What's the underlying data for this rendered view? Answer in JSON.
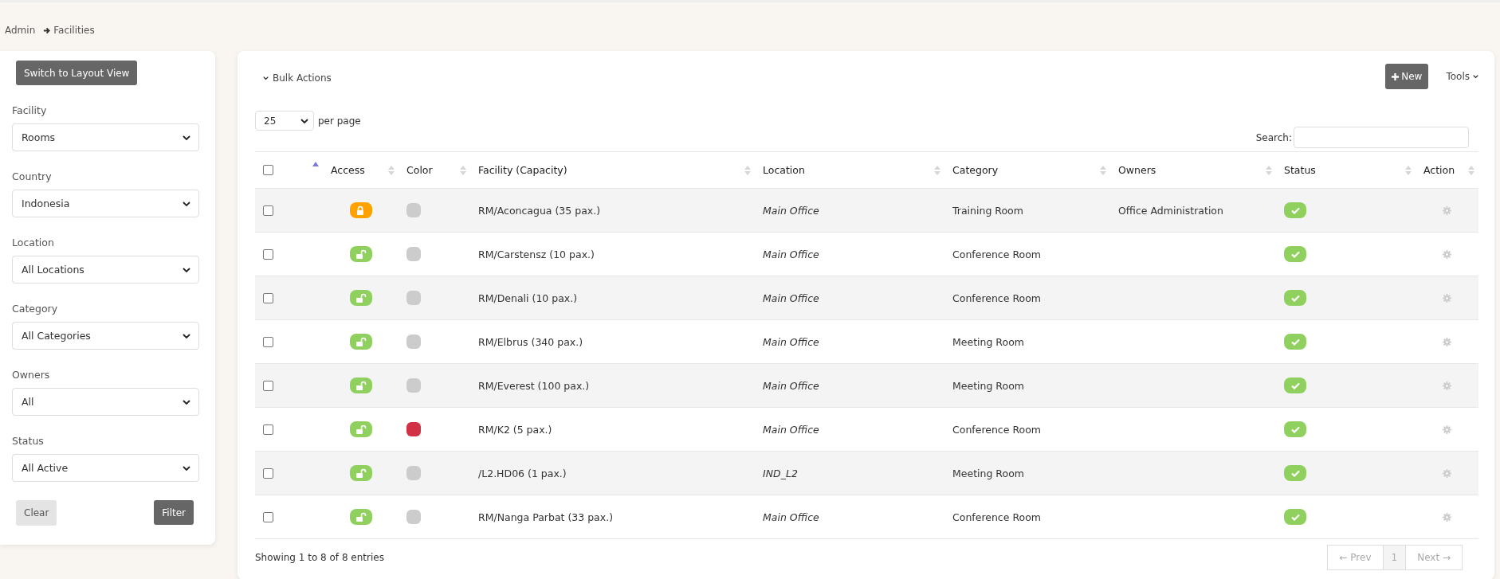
{
  "breadcrumb": {
    "items": [
      "Admin",
      "Facilities"
    ]
  },
  "filters": {
    "switch_button": "Switch to Layout View",
    "fields": [
      {
        "label": "Facility",
        "value": "Rooms"
      },
      {
        "label": "Country",
        "value": "Indonesia"
      },
      {
        "label": "Location",
        "value": "All Locations"
      },
      {
        "label": "Category",
        "value": "All Categories"
      },
      {
        "label": "Owners",
        "value": "All"
      },
      {
        "label": "Status",
        "value": "All Active"
      }
    ],
    "clear_button": "Clear",
    "filter_button": "Filter"
  },
  "toolbar": {
    "bulk_actions": "Bulk Actions",
    "new_button": "New",
    "tools": "Tools"
  },
  "page_size": {
    "value": "25",
    "label": "per page"
  },
  "search": {
    "label": "Search:"
  },
  "table": {
    "select_all": {
      "checked": false
    },
    "columns": [
      {
        "kind": "checkbox",
        "sorted": true
      },
      {
        "kind": "text",
        "label": "Access",
        "sorted": false
      },
      {
        "kind": "text",
        "label": "Color",
        "sorted": false
      },
      {
        "kind": "text",
        "label": "Facility (Capacity)",
        "sorted": false
      },
      {
        "kind": "text",
        "label": "Location",
        "sorted": false
      },
      {
        "kind": "text",
        "label": "Category",
        "sorted": false
      },
      {
        "kind": "text",
        "label": "Owners",
        "sorted": false
      },
      {
        "kind": "text",
        "label": "Status",
        "sorted": false
      },
      {
        "kind": "text",
        "label": "Action",
        "sorted": false
      }
    ],
    "rows": [
      {
        "checked": false,
        "locked": true,
        "color": "#cccccc",
        "facility": "RM/Aconcagua (35 pax.)",
        "location": "Main Office",
        "category": "Training Room",
        "owners": "Office Administration",
        "active": true
      },
      {
        "checked": false,
        "locked": false,
        "color": "#cccccc",
        "facility": "RM/Carstensz (10 pax.)",
        "location": "Main Office",
        "category": "Conference Room",
        "active": true
      },
      {
        "checked": false,
        "locked": false,
        "color": "#cccccc",
        "facility": "RM/Denali (10 pax.)",
        "location": "Main Office",
        "category": "Conference Room",
        "active": true
      },
      {
        "checked": false,
        "locked": false,
        "color": "#cccccc",
        "facility": "RM/Elbrus (340 pax.)",
        "location": "Main Office",
        "category": "Meeting Room",
        "active": true
      },
      {
        "checked": false,
        "locked": false,
        "color": "#cccccc",
        "facility": "RM/Everest (100 pax.)",
        "location": "Main Office",
        "category": "Meeting Room",
        "active": true
      },
      {
        "checked": false,
        "locked": false,
        "color": "#d23145",
        "facility": "RM/K2 (5 pax.)",
        "location": "Main Office",
        "category": "Conference Room",
        "active": true
      },
      {
        "checked": false,
        "locked": false,
        "color": "#cccccc",
        "facility": "/L2.HD06 (1 pax.)",
        "location": "IND_L2",
        "category": "Meeting Room",
        "active": true
      },
      {
        "checked": false,
        "locked": false,
        "color": "#cccccc",
        "facility": "RM/Nanga Parbat (33 pax.)",
        "location": "Main Office",
        "category": "Conference Room",
        "active": true
      }
    ]
  },
  "footer": {
    "info": "Showing 1 to 8 of 8 entries",
    "pagination": [
      {
        "label": "← Prev",
        "selected": false
      },
      {
        "label": "1",
        "selected": true
      },
      {
        "label": "Next →",
        "selected": false
      }
    ]
  }
}
